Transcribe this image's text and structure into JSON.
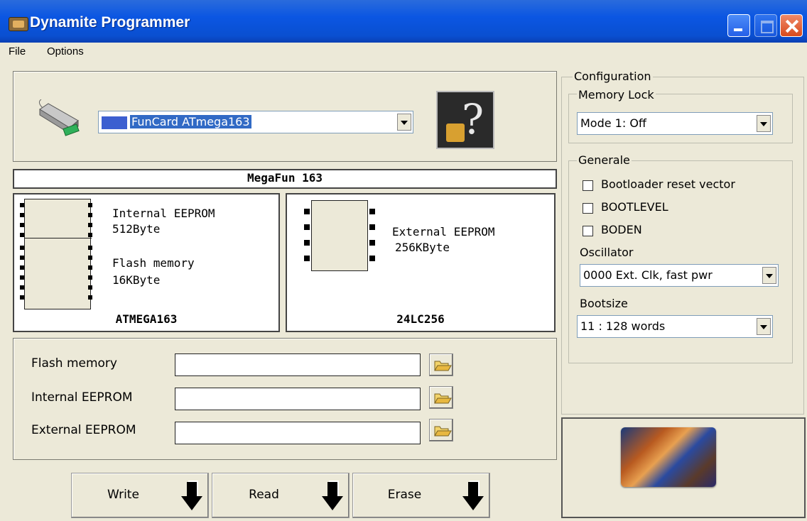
{
  "window": {
    "title": "Dynamite Programmer"
  },
  "menu": {
    "file": "File",
    "options": "Options"
  },
  "device": {
    "selected": "FunCard ATmega163",
    "help_glyph": "?"
  },
  "board_name": "MegaFun 163",
  "chips": {
    "left": {
      "name": "ATMEGA163",
      "mem1": "Internal EEPROM",
      "mem1_size": "512Byte",
      "mem2": "Flash memory",
      "mem2_size": "16KByte"
    },
    "right": {
      "name": "24LC256",
      "mem1": "External EEPROM",
      "mem1_size": "256KByte"
    }
  },
  "files": {
    "flash": "Flash memory",
    "internal": "Internal EEPROM",
    "external": "External EEPROM"
  },
  "actions": {
    "write": "Write",
    "read": "Read",
    "erase": "Erase"
  },
  "config": {
    "title": "Configuration",
    "memory_lock": {
      "label": "Memory Lock",
      "value": "Mode 1: Off"
    },
    "generale": {
      "label": "Generale",
      "bootloader": "Bootloader reset vector",
      "bootlevel": "BOOTLEVEL",
      "boden": "BODEN",
      "oscillator_label": "Oscillator",
      "oscillator_value": "0000 Ext. Clk, fast pwr",
      "bootsize_label": "Bootsize",
      "bootsize_value": "11 : 128 words"
    }
  }
}
